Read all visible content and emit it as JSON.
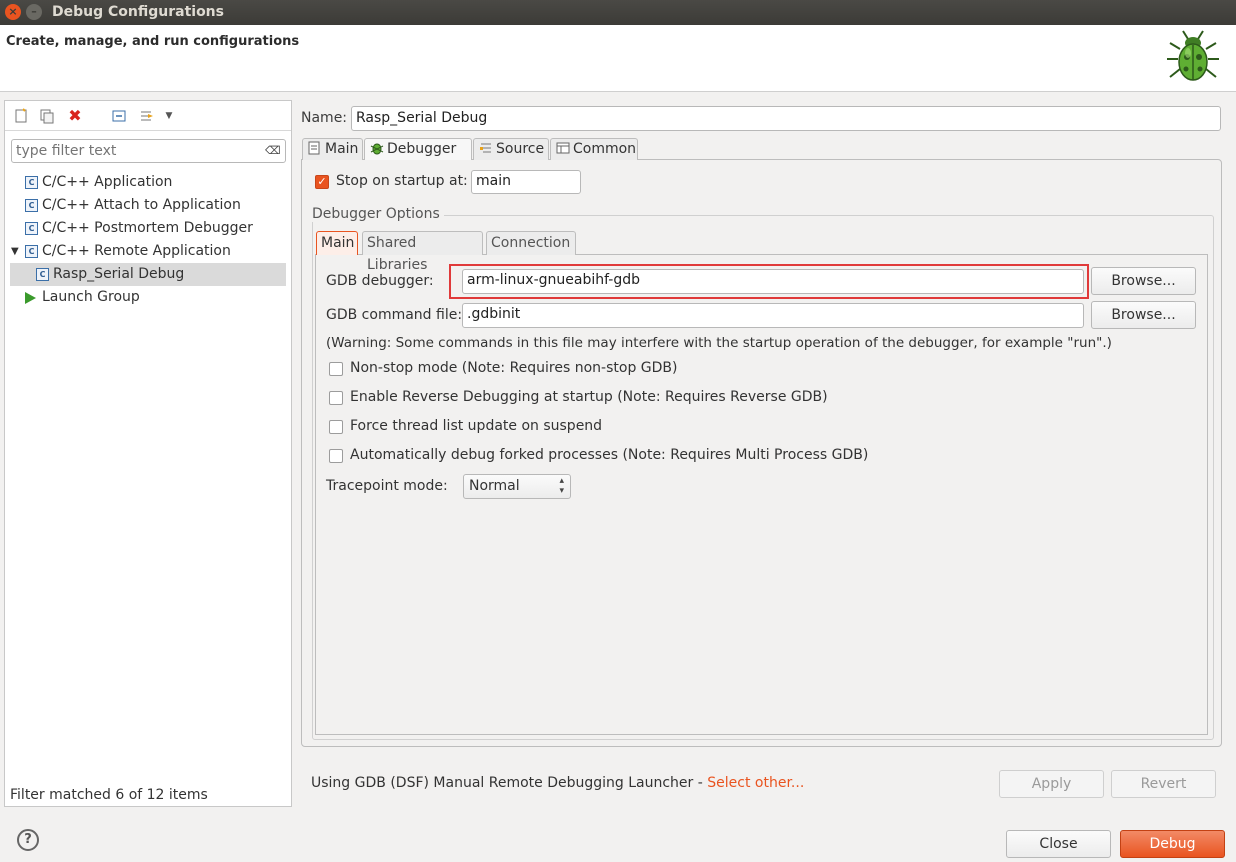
{
  "window": {
    "title": "Debug Configurations",
    "close_glyph": "×",
    "minimize_glyph": "–"
  },
  "header": {
    "title": "Create, manage, and run configurations"
  },
  "left": {
    "toolbar_icons": [
      "new-config-icon",
      "duplicate-icon",
      "delete-icon",
      "collapse-all-icon",
      "filter-icon",
      "menu-dropdown-icon"
    ],
    "filter_placeholder": "type filter text",
    "tree": [
      {
        "label": "C/C++ Application",
        "icon": "c-config-icon"
      },
      {
        "label": "C/C++ Attach to Application",
        "icon": "c-config-icon"
      },
      {
        "label": "C/C++ Postmortem Debugger",
        "icon": "c-config-icon"
      },
      {
        "label": "C/C++ Remote Application",
        "icon": "c-config-icon",
        "expanded": true
      },
      {
        "label": "Rasp_Serial Debug",
        "icon": "c-config-icon",
        "selected": true
      },
      {
        "label": "Launch Group",
        "icon": "launch-group-icon"
      }
    ],
    "status": "Filter matched 6 of 12 items"
  },
  "config": {
    "name_label": "Name:",
    "name_value": "Rasp_Serial Debug",
    "tabs": [
      "Main",
      "Debugger",
      "Source",
      "Common"
    ],
    "active_tab": "Debugger",
    "stop_on_startup_label": "Stop on startup at:",
    "stop_on_startup_checked": true,
    "stop_on_startup_value": "main",
    "group_label": "Debugger Options",
    "inner_tabs": [
      "Main",
      "Shared Libraries",
      "Connection"
    ],
    "active_inner_tab": "Main",
    "gdb_debugger_label": "GDB debugger:",
    "gdb_debugger_value": "arm-linux-gnueabihf-gdb",
    "gdb_command_label": "GDB command file:",
    "gdb_command_value": ".gdbinit",
    "browse_label": "Browse...",
    "warning": "(Warning: Some commands in this file may interfere with the startup operation of the debugger, for example \"run\".)",
    "options": [
      {
        "label": "Non-stop mode (Note: Requires non-stop GDB)",
        "checked": false
      },
      {
        "label": "Enable Reverse Debugging at startup (Note: Requires Reverse GDB)",
        "checked": false
      },
      {
        "label": "Force thread list update on suspend",
        "checked": false
      },
      {
        "label": "Automatically debug forked processes (Note: Requires Multi Process GDB)",
        "checked": false
      }
    ],
    "tracepoint_label": "Tracepoint mode:",
    "tracepoint_value": "Normal"
  },
  "footer": {
    "launcher_text": "Using GDB (DSF) Manual Remote Debugging Launcher - ",
    "launcher_link": "Select other...",
    "apply": "Apply",
    "revert": "Revert",
    "close": "Close",
    "debug": "Debug",
    "help_glyph": "?"
  },
  "colors": {
    "accent": "#e95420",
    "highlight_border": "#e03a3a",
    "selection": "#dadada"
  }
}
